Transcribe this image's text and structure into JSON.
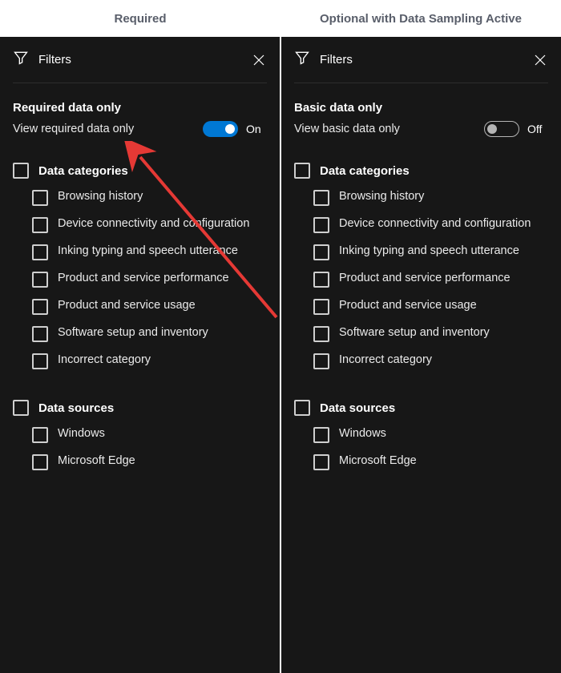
{
  "headers": {
    "left": "Required",
    "right": "Optional with Data Sampling Active"
  },
  "filters_label": "Filters",
  "panels": {
    "left": {
      "section_title": "Required data only",
      "toggle_label": "View required data only",
      "toggle_on": true,
      "toggle_state": "On",
      "categories_title": "Data categories",
      "categories": [
        "Browsing history",
        "Device connectivity and configuration",
        "Inking typing and speech utterance",
        "Product and service performance",
        "Product and service usage",
        "Software setup and inventory",
        "Incorrect category"
      ],
      "sources_title": "Data sources",
      "sources": [
        "Windows",
        "Microsoft Edge"
      ]
    },
    "right": {
      "section_title": "Basic data only",
      "toggle_label": "View basic data only",
      "toggle_on": false,
      "toggle_state": "Off",
      "categories_title": "Data categories",
      "categories": [
        "Browsing history",
        "Device connectivity and configuration",
        "Inking typing and speech utterance",
        "Product and service performance",
        "Product and service usage",
        "Software setup and inventory",
        "Incorrect category"
      ],
      "sources_title": "Data sources",
      "sources": [
        "Windows",
        "Microsoft Edge"
      ]
    }
  },
  "colors": {
    "accent": "#0078d4",
    "panel_bg": "#171717",
    "arrow": "#e53935"
  }
}
